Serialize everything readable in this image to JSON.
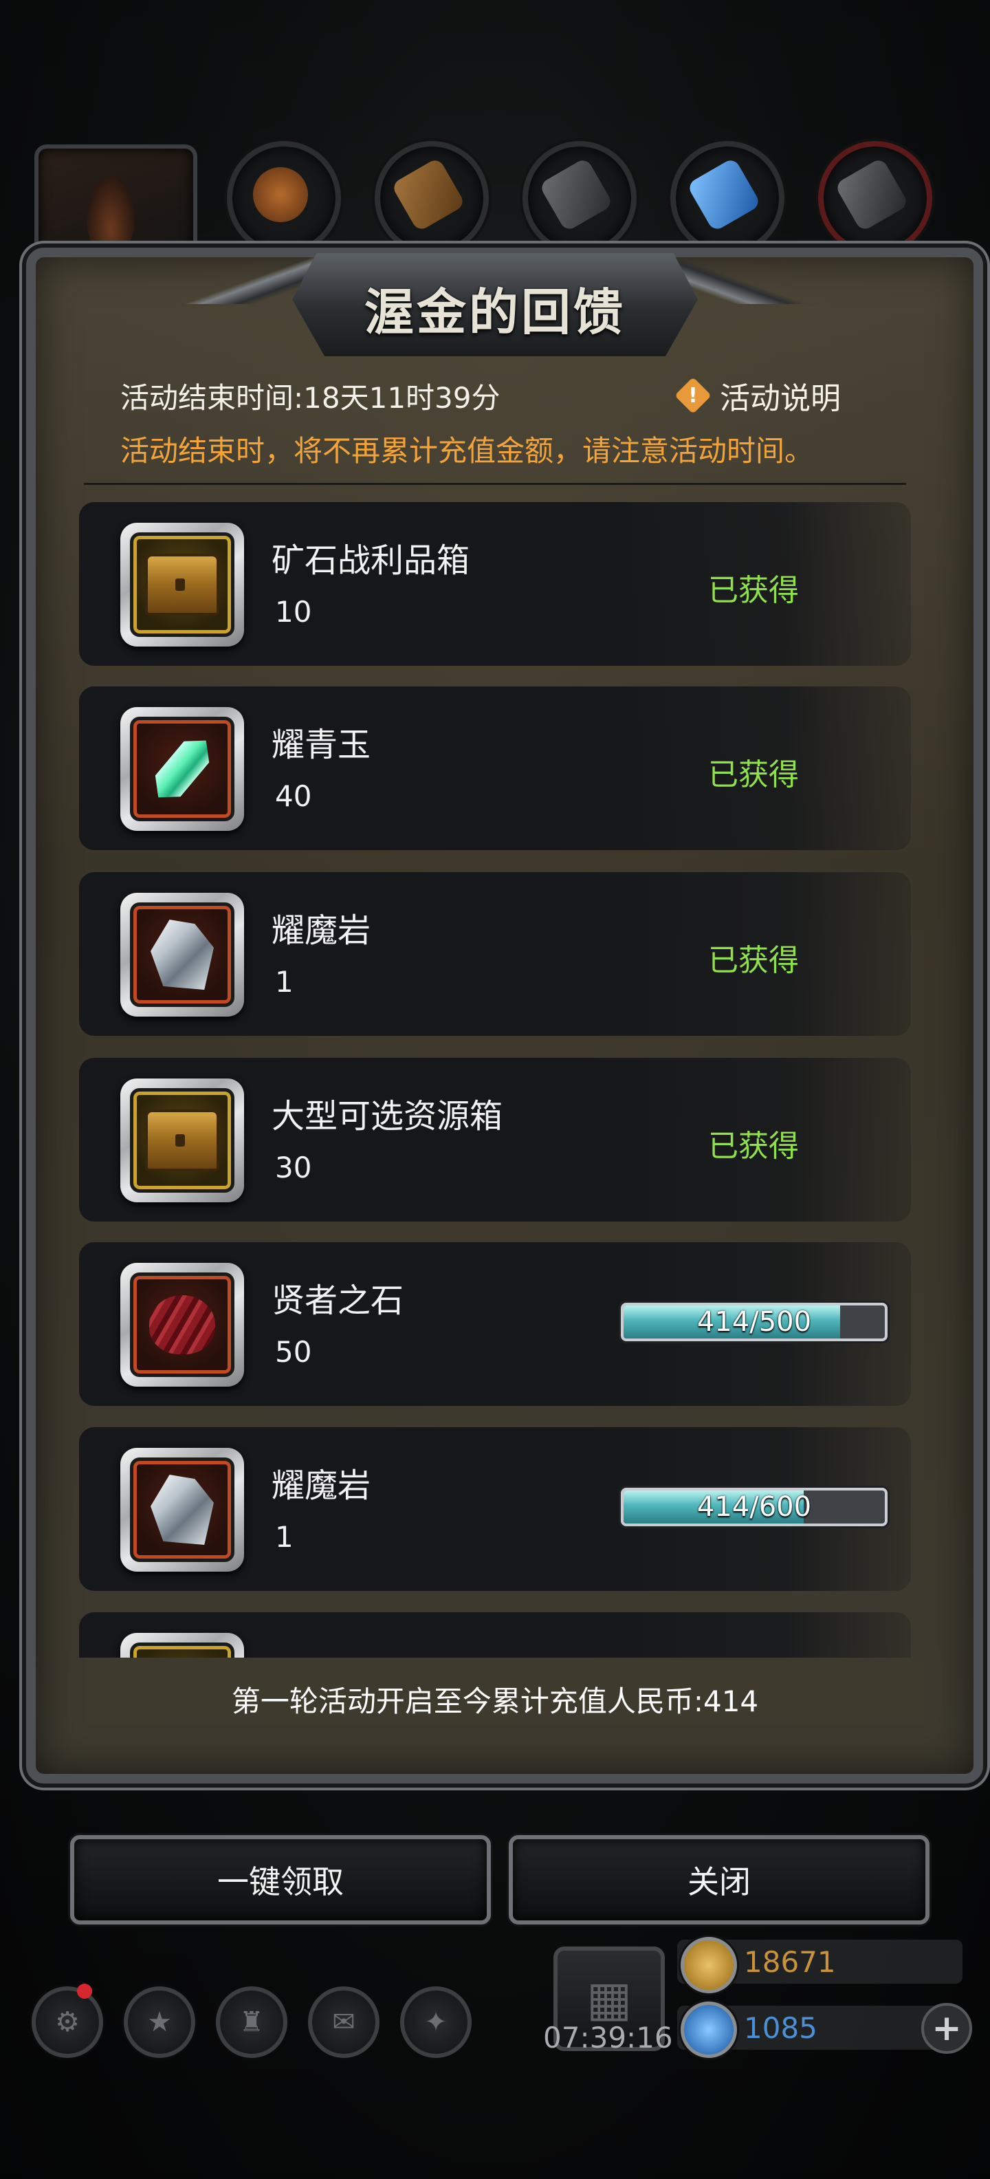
{
  "dialog": {
    "title": "渥金的回馈",
    "end_time": "活动结束时间:18天11时39分",
    "info_label": "活动说明",
    "info_glyph": "!",
    "notice": "活动结束时，将不再累计充值金额，请注意活动时间。",
    "total_recharge": "第一轮活动开启至今累计充值人民币:414"
  },
  "rewards": [
    {
      "name": "矿石战利品箱",
      "qty": "10",
      "icon": "ore-loot-chest-icon",
      "status": "已获得"
    },
    {
      "name": "耀青玉",
      "qty": "40",
      "icon": "jade-crystal-icon",
      "status": "已获得"
    },
    {
      "name": "耀魔岩",
      "qty": "1",
      "icon": "magic-rock-icon",
      "status": "已获得"
    },
    {
      "name": "大型可选资源箱",
      "qty": "30",
      "icon": "resource-chest-icon",
      "status": "已获得"
    },
    {
      "name": "贤者之石",
      "qty": "50",
      "icon": "sage-stone-icon",
      "progress_text": "414/500",
      "progress": 0.828
    },
    {
      "name": "耀魔岩",
      "qty": "1",
      "icon": "magic-rock-icon",
      "progress_text": "414/600",
      "progress": 0.69
    },
    {
      "name": "",
      "qty": "",
      "icon": "chest-icon"
    }
  ],
  "buttons": {
    "claim_all": "一键领取",
    "close": "关闭"
  },
  "hud": {
    "clock": "07:39:16",
    "gold": "18671",
    "gems": "1085",
    "plus": "+"
  },
  "colors": {
    "obtained": "#8fe04a",
    "notice": "#f2a43a",
    "gold_value": "#c9933b",
    "gem_value": "#4b8fd6"
  }
}
